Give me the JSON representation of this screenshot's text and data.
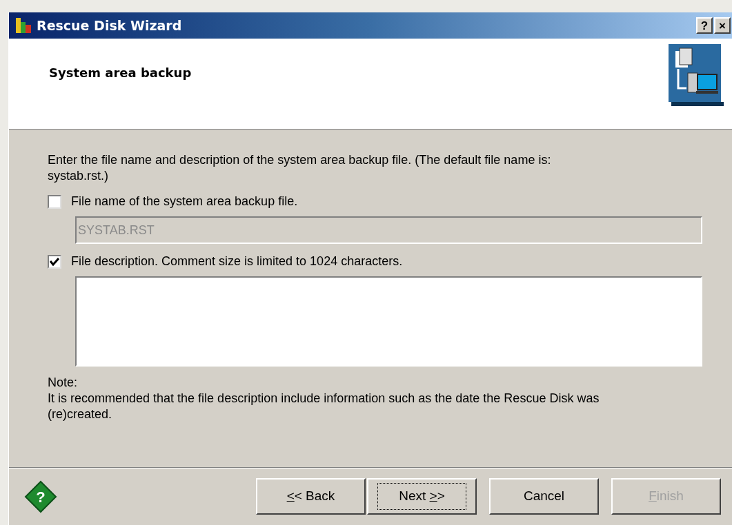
{
  "window": {
    "title": "Rescue Disk Wizard",
    "controls": [
      "?",
      "×"
    ]
  },
  "header": {
    "title": "System area backup"
  },
  "intro": "Enter the file name and description of the system area backup file. (The default file name is: systab.rst.)",
  "options": [
    {
      "label": "File name of the system area backup file.",
      "checked": false,
      "kind": "line",
      "value": "SYSTAB.RST",
      "disabled": true
    },
    {
      "label": "File description. Comment size is limited to 1024 characters.",
      "checked": true,
      "kind": "area",
      "disabled": false
    }
  ],
  "note": {
    "heading": "Note:",
    "text": "It is recommended that the file description include information such as the date the Rescue Disk was (re)created."
  },
  "help_glyph": "?",
  "buttons": [
    {
      "key": "<",
      "rest": "< Back",
      "focused": false,
      "disabled": false
    },
    {
      "text": "Next ",
      "key": ">",
      "rest": ">",
      "focused": true,
      "disabled": false
    },
    {
      "text": "Cancel",
      "focused": false,
      "disabled": false
    },
    {
      "key": "F",
      "rest": "inish",
      "focused": false,
      "disabled": true
    }
  ]
}
